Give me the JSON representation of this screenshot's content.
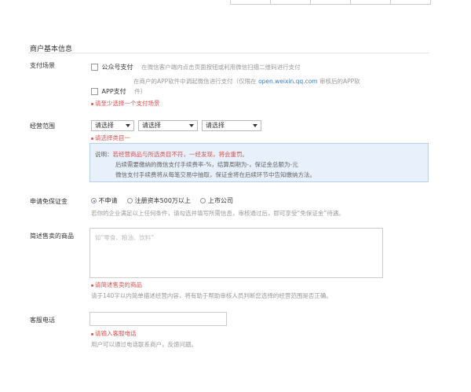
{
  "section": {
    "title": "商户基本信息"
  },
  "payment_scene": {
    "label": "支付场景",
    "options": [
      {
        "label": "公众号支付",
        "desc": "在微信客户端内点击页面按钮或利用微信扫描二维码进行支付"
      },
      {
        "label": "APP支付",
        "desc_line1_pre": "在商户的APP软件中调起微信进行支付（仅限在",
        "desc_line1_link": "open.weixin.qq.com",
        "desc_line1_post": "审核后的APP软",
        "desc_line2": "件）"
      }
    ],
    "error": "请至少选择一个支付场景"
  },
  "business_scope": {
    "label": "经营范围",
    "selects": [
      "请选择",
      "请选择",
      "请选择"
    ],
    "error": "请选择类目一",
    "note": {
      "line1_pre": "说明：",
      "line1_hl": "若经营商品与所选类目不符，一经发现，将会重罚。",
      "line2": "后续需要缴纳的微信支付手续费率-%，结算周期为-，保证金总额为-元",
      "line3": "微信支付手续费将从每笔交易中抽取，保证金将在后续环节中告知缴纳方法。"
    }
  },
  "deposit_waiver": {
    "label": "申请免保证金",
    "options": [
      "不申请",
      "注册资本500万以上",
      "上市公司"
    ],
    "selected": 0,
    "hint": "若你的企业满足以上任何条件，请勾选并填写所需信息，审核通过后，即可享受“免保证金”待遇。"
  },
  "goods": {
    "label": "简述售卖的商品",
    "placeholder": "如“零食、粮油、饮料”",
    "error": "请简述售卖的商品",
    "hint": "请于140字以内简单描述经营内容，将有助于帮助审核人员判断您选择的经营范围是否正确。"
  },
  "service_phone": {
    "label": "客服电话",
    "error": "请输入客服电话",
    "hint": "用户可以通过电话联系商户，反馈问题。"
  }
}
